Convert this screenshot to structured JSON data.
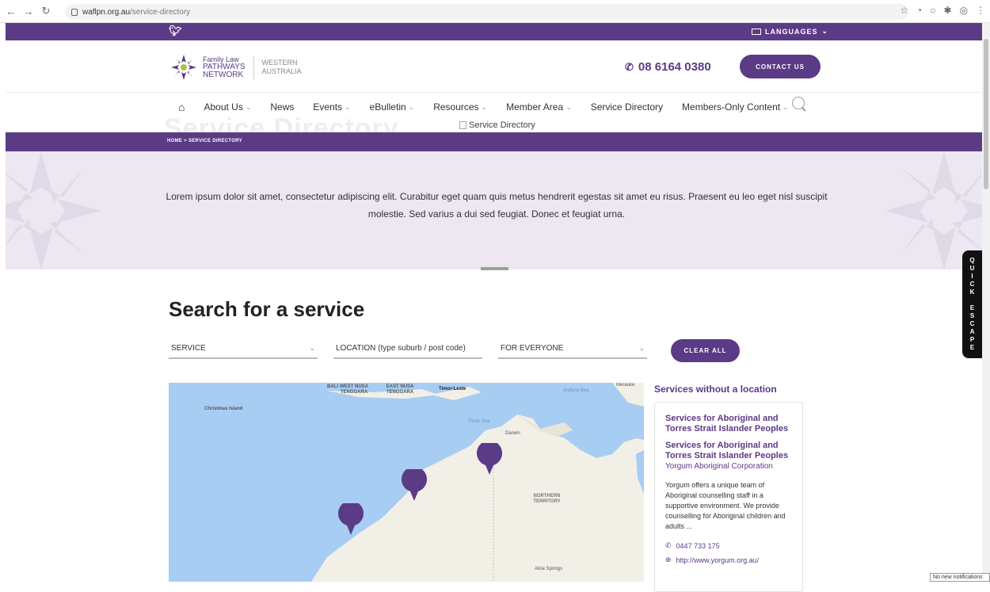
{
  "browser": {
    "url_domain": "waflpn.org.au",
    "url_path": "/service-directory"
  },
  "topbar": {
    "languages_label": "LANGUAGES"
  },
  "header": {
    "logo_line1": "Family Law",
    "logo_line2": "PATHWAYS",
    "logo_line3": "NETWORK",
    "region_line1": "WESTERN",
    "region_line2": "AUSTRALIA",
    "phone": "08 6164 0380",
    "contact_label": "CONTACT US"
  },
  "nav": {
    "items": [
      {
        "label": "About Us",
        "dropdown": true
      },
      {
        "label": "News",
        "dropdown": false
      },
      {
        "label": "Events",
        "dropdown": true
      },
      {
        "label": "eBulletin",
        "dropdown": true
      },
      {
        "label": "Resources",
        "dropdown": true
      },
      {
        "label": "Member Area",
        "dropdown": true
      },
      {
        "label": "Service Directory",
        "dropdown": false
      },
      {
        "label": "Members-Only Content",
        "dropdown": true
      }
    ]
  },
  "banner": {
    "ghost_title": "Service Directory",
    "broken_image_alt": "Service Directory"
  },
  "breadcrumb": "HOME > SERVICE DIRECTORY",
  "hero_text": "Lorem ipsum dolor sit amet, consectetur adipiscing elit. Curabitur eget quam quis metus hendrerit egestas sit amet eu risus. Praesent eu leo eget nisl suscipit molestie. Sed varius a dui sed feugiat. Donec et feugiat urna.",
  "quick_escape": [
    "Q",
    "U",
    "I",
    "C",
    "K",
    "",
    "E",
    "S",
    "C",
    "A",
    "P",
    "E"
  ],
  "search": {
    "title": "Search for a service",
    "service_select": "SERVICE",
    "location_placeholder": "LOCATION (type suburb / post code)",
    "audience_select": "FOR EVERYONE",
    "clear_label": "CLEAR ALL"
  },
  "map": {
    "labels": {
      "christmas": "Christmas Island",
      "bali": "BALI",
      "west_nusa": "WEST NUSA TENGGARA",
      "east_nusa": "EAST NUSA TENGGARA",
      "timor_leste": "Timor-Leste",
      "arafura": "Arafura Sea",
      "merauke": "Merauke",
      "timor_sea": "Timor Sea",
      "darwin": "Darwin",
      "nt": "NORTHERN TERRITORY",
      "alice": "Alice Springs"
    },
    "pin_color": "#5b3a86"
  },
  "sidebar": {
    "heading": "Services without a location",
    "card": {
      "title1": "Services for Aboriginal and Torres Strait Islander Peoples",
      "title2": "Services for Aboriginal and Torres Strait Islander Peoples",
      "org": "Yorgum Aboriginal Corporation",
      "desc": "Yorgum offers a unique team of Aboriginal counselling staff in a supportive environment. We provide counselling for Aboriginal children and adults ...",
      "phone": "0447 733 175",
      "website": "http://www.yorgum.org.au/"
    }
  },
  "toast": "No new notifications",
  "colors": {
    "brand": "#5b3a86",
    "hero_bg": "#ece7f0"
  }
}
